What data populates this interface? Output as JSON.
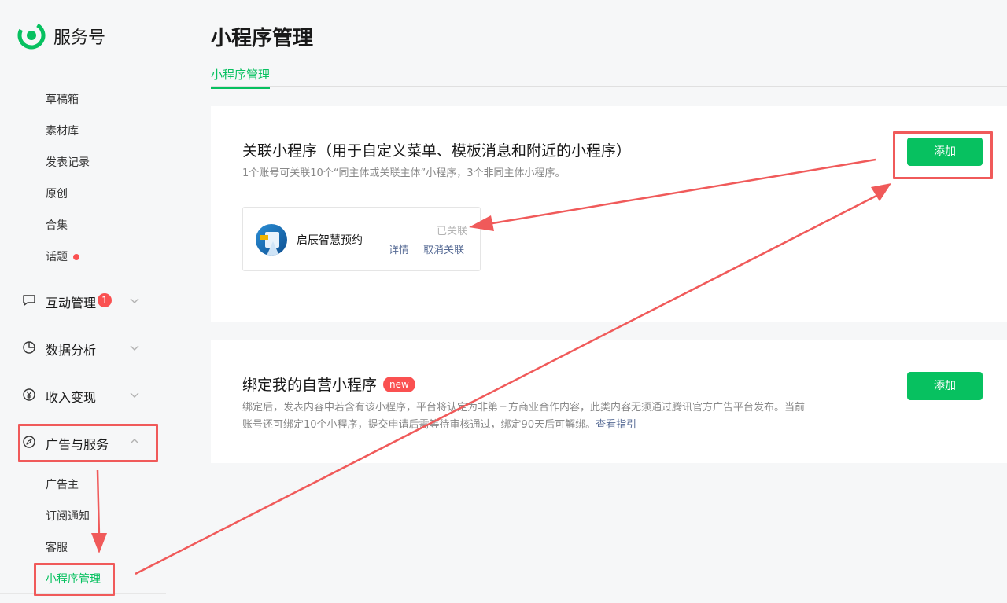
{
  "brand": {
    "name": "服务号",
    "logo_icon": "wechat-service-logo-icon",
    "logo_color": "#07c160"
  },
  "sidebar": {
    "publish_items": [
      {
        "label": "草稿箱"
      },
      {
        "label": "素材库"
      },
      {
        "label": "发表记录"
      },
      {
        "label": "原创"
      },
      {
        "label": "合集"
      },
      {
        "label": "话题",
        "has_dot": true
      }
    ],
    "groups": [
      {
        "label": "互动管理",
        "icon": "chat-bubble-icon",
        "badge": "1",
        "expanded": false
      },
      {
        "label": "数据分析",
        "icon": "pie-chart-icon",
        "expanded": false
      },
      {
        "label": "收入变现",
        "icon": "yen-icon",
        "expanded": false
      },
      {
        "label": "广告与服务",
        "icon": "compass-icon",
        "expanded": true
      }
    ],
    "ad_service_items": [
      {
        "label": "广告主"
      },
      {
        "label": "订阅通知"
      },
      {
        "label": "客服"
      },
      {
        "label": "小程序管理",
        "active": true
      }
    ]
  },
  "main": {
    "title": "小程序管理",
    "tabs": [
      {
        "label": "小程序管理",
        "active": true
      }
    ],
    "linked_section": {
      "title": "关联小程序（用于自定义菜单、模板消息和附近的小程序）",
      "subtitle": "1个账号可关联10个“同主体或关联主体”小程序，3个非同主体小程序。",
      "add_label": "添加",
      "mini_program": {
        "name": "启辰智慧预约",
        "status": "已关联",
        "details_label": "详情",
        "unlink_label": "取消关联"
      }
    },
    "bind_section": {
      "title": "绑定我的自营小程序",
      "badge": "new",
      "desc_line1": "绑定后，发表内容中若含有该小程序，平台将认定为非第三方商业合作内容，此类内容无须通过腾讯官方广告平台发布。当前",
      "desc_line2": "账号还可绑定10个小程序，提交申请后需等待审核通过，绑定90天后可解绑。",
      "guide_link": "查看指引",
      "add_label": "添加"
    }
  },
  "colors": {
    "accent": "#07c160",
    "badge": "#fa5151",
    "link": "#576b95",
    "annotation": "#f05a5a"
  }
}
